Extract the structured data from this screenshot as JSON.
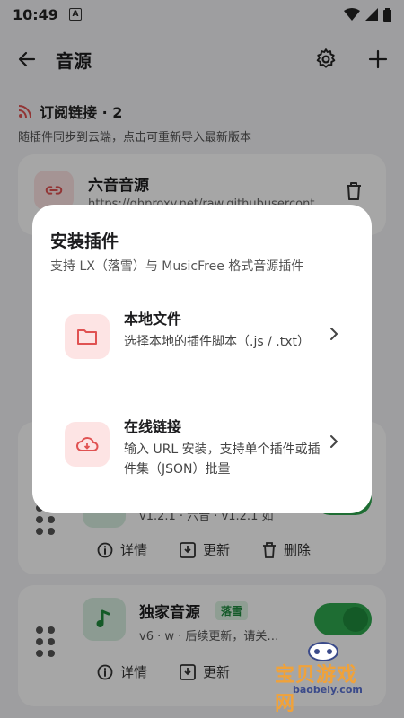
{
  "status_bar": {
    "time": "10:49",
    "badge": "A"
  },
  "app_bar": {
    "title": "音源"
  },
  "subscription": {
    "heading": "订阅链接 · 2",
    "description": "随插件同步到云端，点击可重新导入最新版本",
    "item": {
      "name": "六音音源",
      "url": "https://ghproxy.net/raw.githubusercont"
    }
  },
  "plugins": [
    {
      "name": "",
      "meta": "v1.2.1 · 六音 · v1.2.1 如",
      "actions": {
        "details": "详情",
        "update": "更新",
        "delete": "删除"
      }
    },
    {
      "name": "独家音源",
      "badge": "落雪",
      "meta": "v6 · w · 后续更新，请关…",
      "actions": {
        "details": "详情",
        "update": "更新"
      }
    }
  ],
  "dialog": {
    "title": "安装插件",
    "subtitle": "支持 LX（落雪）与 MusicFree 格式音源插件",
    "options": [
      {
        "title": "本地文件",
        "description": "选择本地的插件脚本（.js / .txt）"
      },
      {
        "title": "在线链接",
        "description": "输入 URL 安装，支持单个插件或插件集（JSON）批量"
      }
    ]
  },
  "watermark": {
    "text": "宝贝游戏网",
    "url": "baobeiy.com"
  },
  "colors": {
    "accent": "#e05252",
    "green": "#2fa84f",
    "scrim": "rgba(0,0,0,0.35)"
  }
}
